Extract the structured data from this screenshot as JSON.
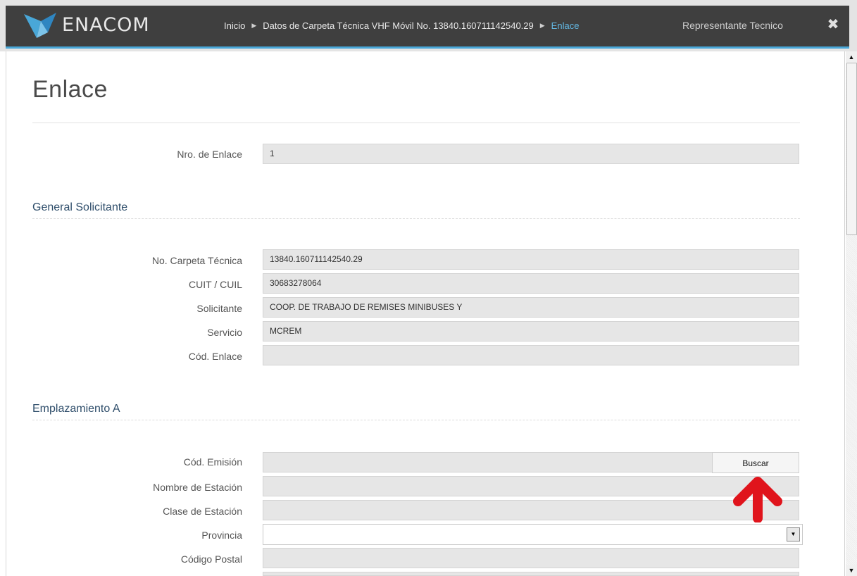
{
  "header": {
    "logo_text": "ENACOM",
    "breadcrumb": {
      "home": "Inicio",
      "folder": "Datos de Carpeta Técnica VHF Móvil No. 13840.160711142540.29",
      "current": "Enlace"
    },
    "user_label": "Representante Tecnico",
    "close_glyph": "✖"
  },
  "page": {
    "title": "Enlace",
    "nro_enlace": {
      "label": "Nro. de Enlace",
      "value": "1"
    }
  },
  "general_solicitante": {
    "title": "General Solicitante",
    "fields": [
      {
        "label": "No. Carpeta Técnica",
        "value": "13840.160711142540.29"
      },
      {
        "label": "CUIT / CUIL",
        "value": "30683278064"
      },
      {
        "label": "Solicitante",
        "value": "COOP. DE TRABAJO DE REMISES MINIBUSES Y"
      },
      {
        "label": "Servicio",
        "value": "MCREM"
      },
      {
        "label": "Cód. Enlace",
        "value": ""
      }
    ]
  },
  "emplazamiento_a": {
    "title": "Emplazamiento A",
    "cod_emision": {
      "label": "Cód. Emisión",
      "value": ""
    },
    "buscar_label": "Buscar",
    "nombre_estacion": {
      "label": "Nombre de Estación",
      "value": ""
    },
    "clase_estacion": {
      "label": "Clase de Estación",
      "value": ""
    },
    "provincia": {
      "label": "Provincia",
      "selected": ""
    },
    "codigo_postal": {
      "label": "Código Postal",
      "value": ""
    }
  },
  "colors": {
    "header_bg": "#3f3f3f",
    "accent": "#49a7d8",
    "breadcrumb_current": "#63b8e3",
    "section_title": "#2e4d6a",
    "annotation_arrow": "#e0141c"
  },
  "icons": {
    "close": "close-icon",
    "breadcrumb_separator": "caret-right-icon",
    "select_dropdown": "chevron-down-icon",
    "annotation": "red-arrow-up-icon"
  }
}
